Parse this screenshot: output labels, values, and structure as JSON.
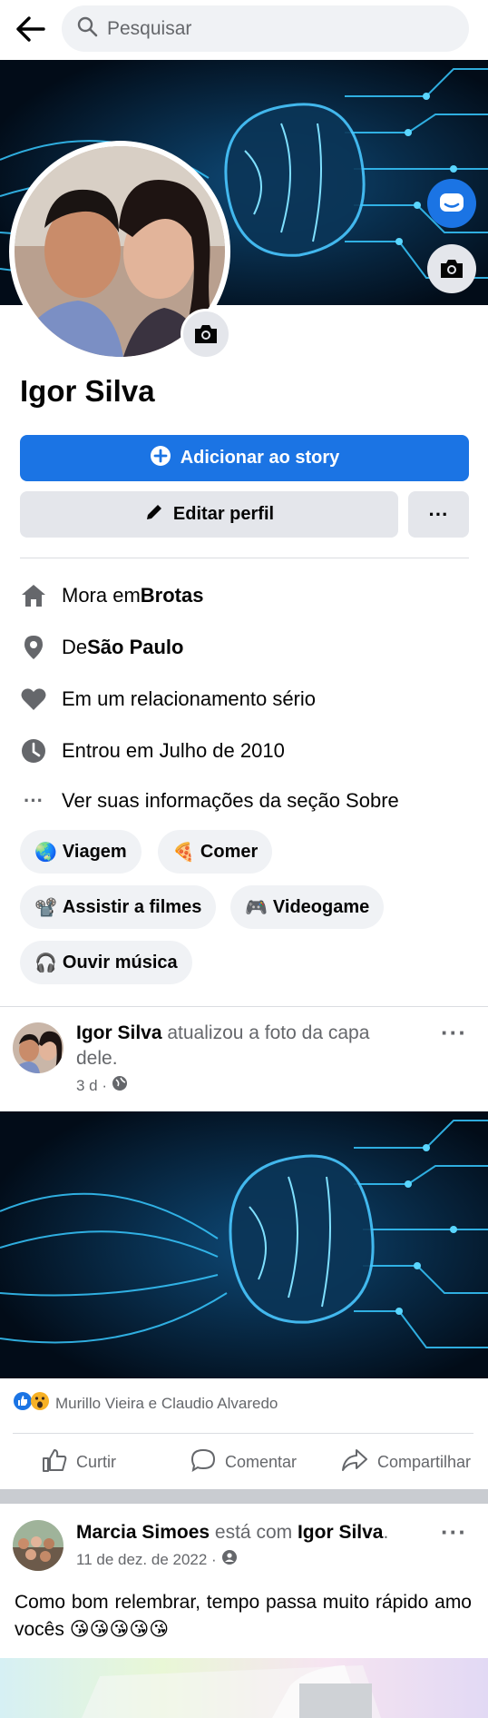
{
  "search": {
    "placeholder": "Pesquisar"
  },
  "profile": {
    "name": "Igor Silva",
    "add_story_label": "Adicionar ao story",
    "edit_profile_label": "Editar perfil",
    "more_label": "···"
  },
  "details": [
    {
      "prefix": "Mora em ",
      "bold": "Brotas"
    },
    {
      "prefix": "De ",
      "bold": "São Paulo"
    },
    {
      "prefix": "Em um relacionamento sério",
      "bold": ""
    },
    {
      "prefix": "Entrou em Julho de 2010",
      "bold": ""
    },
    {
      "prefix": "Ver suas informações da seção Sobre",
      "bold": ""
    }
  ],
  "details_more_icon": "···",
  "hobbies": [
    {
      "emoji": "🌏",
      "label": "Viagem"
    },
    {
      "emoji": "🍕",
      "label": "Comer"
    },
    {
      "emoji": "📽️",
      "label": "Assistir a filmes"
    },
    {
      "emoji": "🎮",
      "label": "Videogame"
    },
    {
      "emoji": "🎧",
      "label": "Ouvir música"
    }
  ],
  "post1": {
    "author": "Igor Silva",
    "action_line1": " atualizou a foto da capa",
    "action_line2": "dele.",
    "time": "3 d ·",
    "more": "···",
    "reactions_text": "Murillo Vieira e Claudio Alvaredo",
    "actions": {
      "like": "Curtir",
      "comment": "Comentar",
      "share": "Compartilhar"
    }
  },
  "post2": {
    "author": "Marcia Simoes",
    "with_text": " está com ",
    "tagged": "Igor Silva",
    "period": ".",
    "time": "11 de dez. de 2022 ·",
    "more": "···",
    "caption": "Como bom relembrar, tempo passa muito rápido amo vocês",
    "caption_emojis": "😘😘😘😘😘"
  },
  "colors": {
    "brand": "#1b74e4",
    "chip_bg": "#f0f2f5",
    "button_bg": "#e4e6eb",
    "muted": "#65676b"
  }
}
